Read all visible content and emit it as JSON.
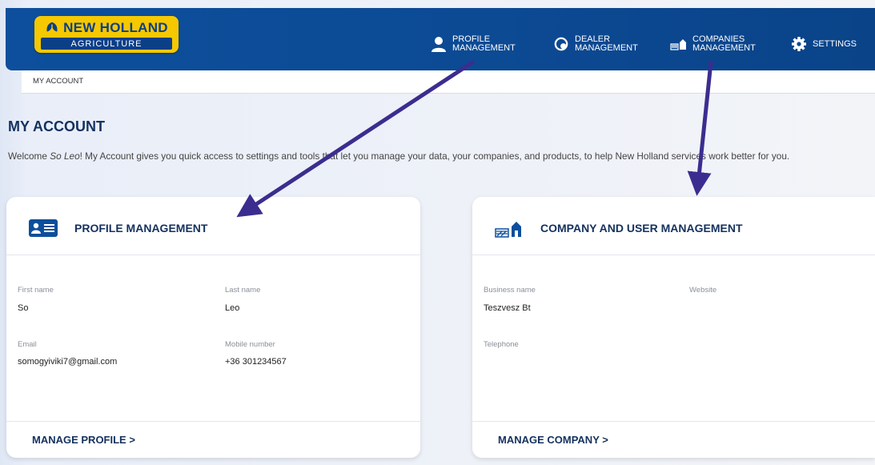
{
  "logo": {
    "brand": "NEW HOLLAND",
    "sub": "AGRICULTURE"
  },
  "nav": [
    {
      "line1": "PROFILE",
      "line2": "MANAGEMENT",
      "icon": "person-icon"
    },
    {
      "line1": "DEALER",
      "line2": "MANAGEMENT",
      "icon": "dealer-icon"
    },
    {
      "line1": "COMPANIES",
      "line2": "MANAGEMENT",
      "icon": "farm-icon"
    },
    {
      "line1": "SETTINGS",
      "line2": "",
      "icon": "gear-icon"
    }
  ],
  "breadcrumb": "MY ACCOUNT",
  "page": {
    "title": "MY ACCOUNT",
    "intro_pre": "Welcome ",
    "intro_name": "So Leo",
    "intro_post": "! My Account gives you quick access to settings and tools that let you manage your data, your companies, and products, to help New Holland services work better for you."
  },
  "profile_card": {
    "title": "PROFILE MANAGEMENT",
    "first_name_label": "First name",
    "first_name": "So",
    "last_name_label": "Last name",
    "last_name": "Leo",
    "email_label": "Email",
    "email": "somogyiviki7@gmail.com",
    "mobile_label": "Mobile number",
    "mobile": "+36 301234567",
    "link": "MANAGE PROFILE >"
  },
  "company_card": {
    "title": "COMPANY AND USER MANAGEMENT",
    "business_label": "Business name",
    "business": "Teszvesz Bt",
    "website_label": "Website",
    "telephone_label": "Telephone",
    "link": "MANAGE COMPANY >"
  },
  "colors": {
    "header": "#0c4a94",
    "accent": "#f6c800",
    "title": "#14315e",
    "arrow": "#3b2d8f"
  }
}
